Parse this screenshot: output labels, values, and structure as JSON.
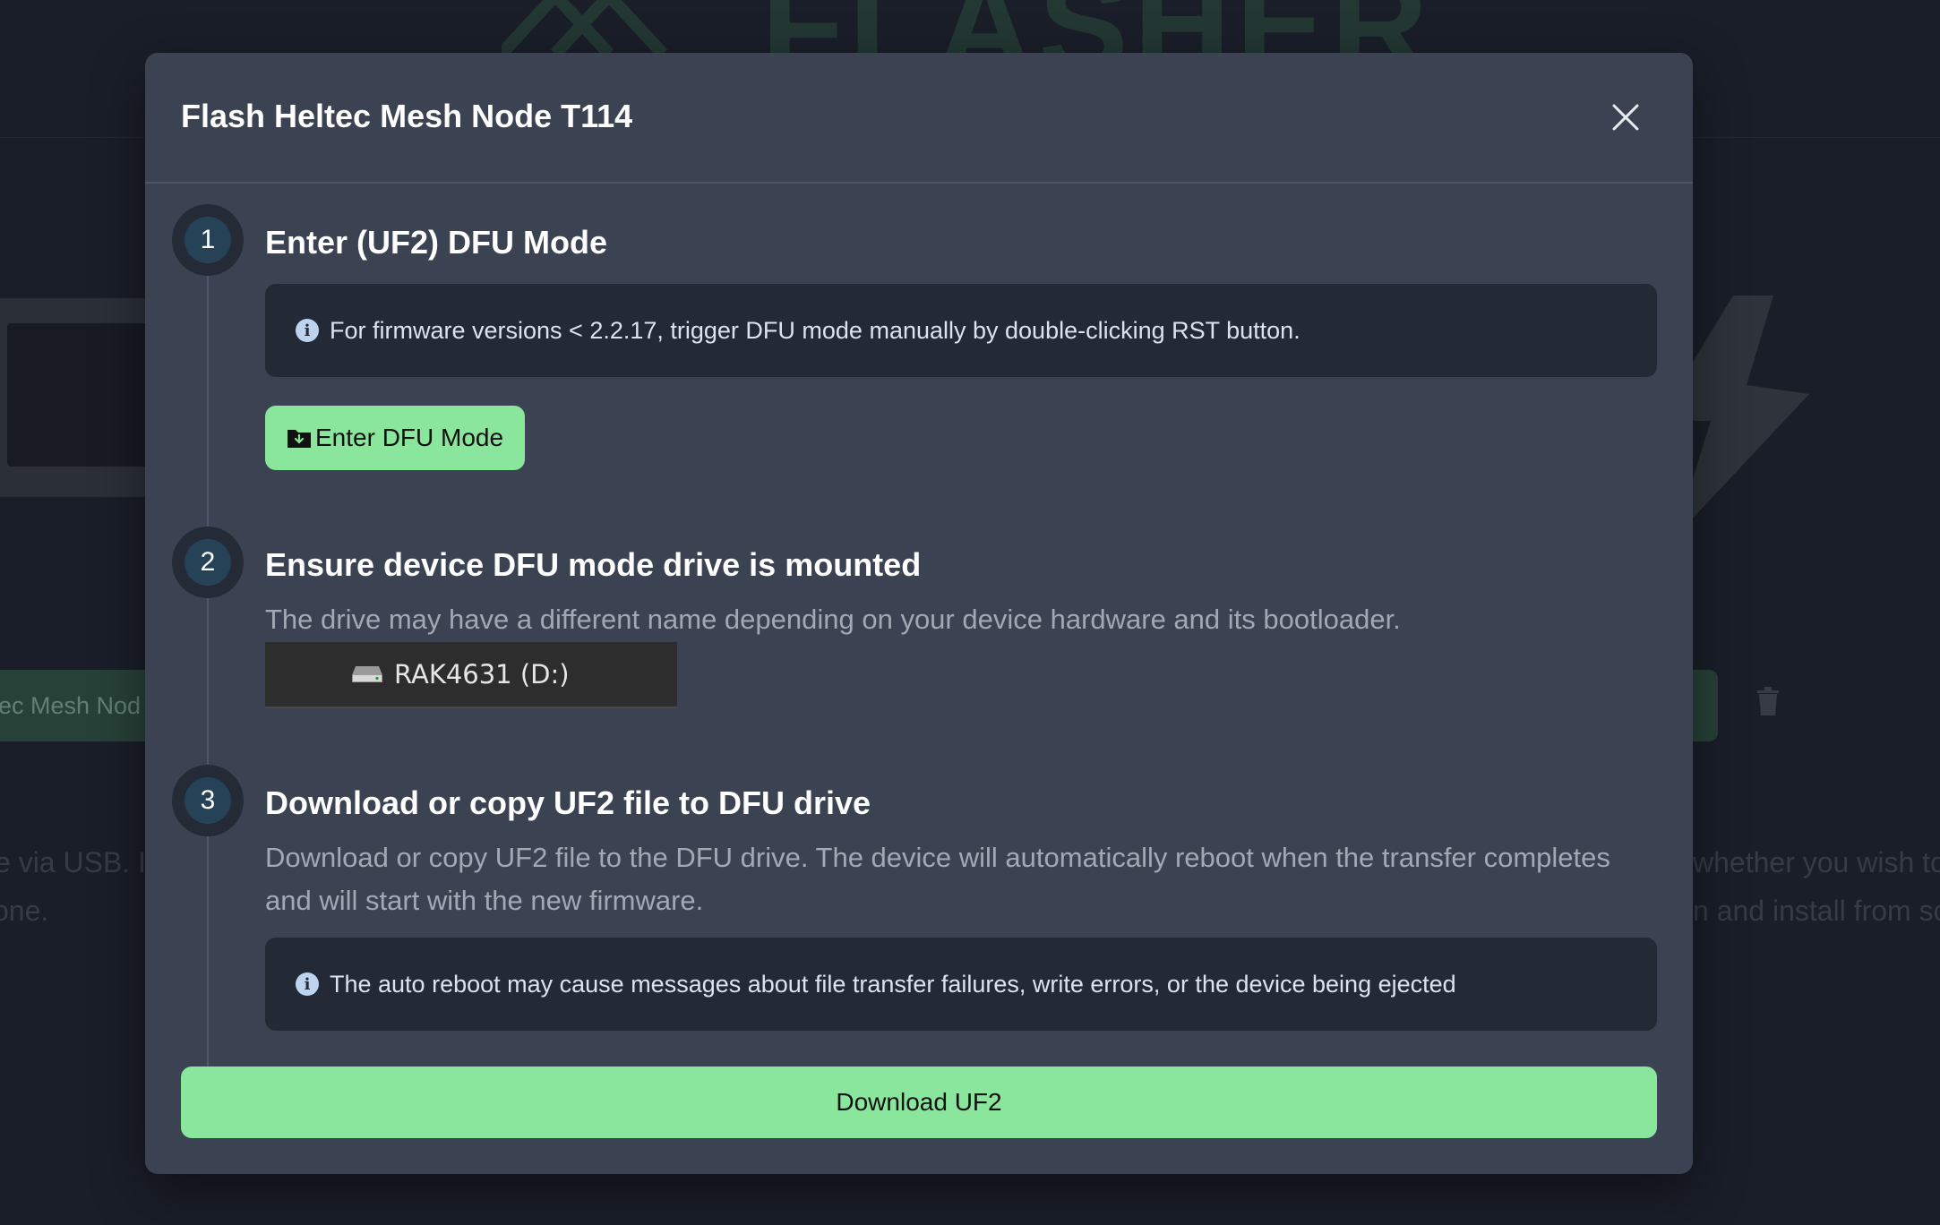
{
  "background": {
    "logo_text": "FLASHER",
    "device_select_text": "ec Mesh Nod",
    "text_left_1": "e via USB. I",
    "text_left_2": "one.",
    "text_right_1": "whether you wish to",
    "text_right_2": "n and install from sc"
  },
  "modal": {
    "title": "Flash Heltec Mesh Node T114",
    "close_icon": "close-icon",
    "steps": [
      {
        "number": "1",
        "title": "Enter (UF2) DFU Mode",
        "info": "For firmware versions < 2.2.17, trigger DFU mode manually by double-clicking RST button.",
        "button_label": "Enter DFU Mode",
        "button_icon": "folder-download-icon"
      },
      {
        "number": "2",
        "title": "Ensure device DFU mode drive is mounted",
        "description": "The drive may have a different name depending on your device hardware and its bootloader.",
        "drive_label": "RAK4631 (D:)",
        "drive_icon": "drive-icon"
      },
      {
        "number": "3",
        "title": "Download or copy UF2 file to DFU drive",
        "description": "Download or copy UF2 file to the DFU drive. The device will automatically reboot when the transfer completes and will start with the new firmware.",
        "info": "The auto reboot may cause messages about file transfer failures, write errors, or the device being ejected"
      }
    ],
    "download_button": "Download UF2"
  },
  "colors": {
    "accent_green": "#8ae69c",
    "modal_bg": "#3b4251",
    "page_bg": "#1f2430",
    "info_bg": "#232935",
    "step_badge": "#264257"
  }
}
